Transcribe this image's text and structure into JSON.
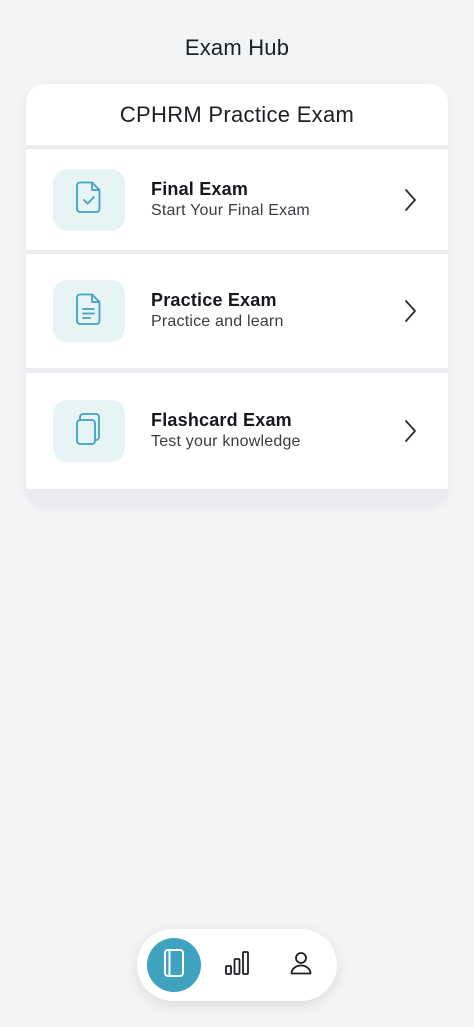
{
  "header": {
    "title": "Exam Hub"
  },
  "card": {
    "title": "CPHRM Practice Exam",
    "items": [
      {
        "title": "Final Exam",
        "subtitle": "Start Your Final Exam",
        "icon": "document-check-icon"
      },
      {
        "title": "Practice Exam",
        "subtitle": "Practice and learn",
        "icon": "document-text-icon"
      },
      {
        "title": "Flashcard Exam",
        "subtitle": "Test your knowledge",
        "icon": "copy-cards-icon"
      }
    ]
  },
  "bottom_nav": {
    "items": [
      {
        "icon": "notebook-icon",
        "active": true
      },
      {
        "icon": "bar-chart-icon",
        "active": false
      },
      {
        "icon": "user-icon",
        "active": false
      }
    ]
  },
  "colors": {
    "accent": "#3fa3bf",
    "icon_tile_bg": "#e6f4f6",
    "background": "#f3f4f6"
  }
}
